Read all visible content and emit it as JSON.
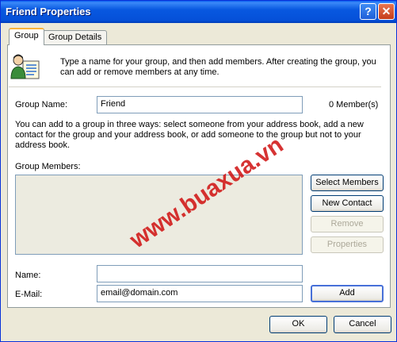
{
  "window": {
    "title": "Friend Properties",
    "help_glyph": "?",
    "close_glyph": "✕"
  },
  "tabs": [
    {
      "label": "Group"
    },
    {
      "label": "Group Details"
    }
  ],
  "intro": {
    "text": "Type a name for your group, and then add members. After creating the group, you can add or remove members at any time.",
    "icon": "group-users-icon"
  },
  "group_name": {
    "label": "Group Name:",
    "value": "Friend",
    "member_count": "0 Member(s)"
  },
  "instructions": "You can add to a group in three ways: select someone from your address book, add a new contact for the group and your address book, or add someone to the group but not to your address book.",
  "members": {
    "label": "Group Members:",
    "buttons": {
      "select": "Select Members",
      "new_contact": "New Contact",
      "remove": "Remove",
      "properties": "Properties"
    }
  },
  "entry": {
    "name_label": "Name:",
    "name_value": "",
    "email_label": "E-Mail:",
    "email_value": "email@domain.com",
    "add_button": "Add"
  },
  "dialog_buttons": {
    "ok": "OK",
    "cancel": "Cancel"
  },
  "watermark": "www.buaxua.vn",
  "colors": {
    "titlebar": "#0858e0",
    "dialog_bg": "#ece9d8",
    "tab_highlight": "#f8b33c",
    "watermark": "#d01010"
  }
}
